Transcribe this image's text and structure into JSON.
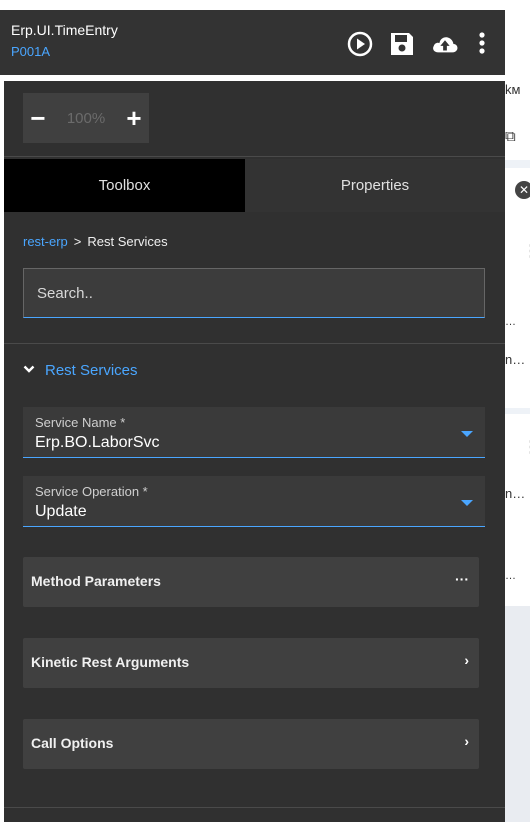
{
  "header": {
    "title": "Erp.UI.TimeEntry",
    "subtitle": "P001A",
    "icons": [
      "play-icon",
      "save-icon",
      "upload-cloud-icon",
      "more-vertical-icon"
    ]
  },
  "background_app": {
    "fragments": [
      "kм",
      "…",
      "n…",
      "…",
      "n…",
      "…"
    ]
  },
  "zoom": {
    "minus_label": "−",
    "value": "100%",
    "plus_label": "+"
  },
  "tabs": [
    {
      "label": "Toolbox",
      "active": true
    },
    {
      "label": "Properties",
      "active": false
    }
  ],
  "breadcrumb": {
    "link": "rest-erp",
    "separator": ">",
    "current": "Rest Services"
  },
  "search": {
    "placeholder": "Search.."
  },
  "section": {
    "label": "Rest Services",
    "expanded": true
  },
  "fields": [
    {
      "label": "Service Name *",
      "value": "Erp.BO.LaborSvc"
    },
    {
      "label": "Service Operation *",
      "value": "Update"
    }
  ],
  "cards": [
    {
      "label": "Method Parameters",
      "action": "···"
    },
    {
      "label": "Kinetic Rest Arguments",
      "action": "›"
    },
    {
      "label": "Call Options",
      "action": "›"
    }
  ],
  "colors": {
    "accent": "#4aa6ff",
    "panel_bg": "#303030",
    "header_bg": "#333333"
  }
}
